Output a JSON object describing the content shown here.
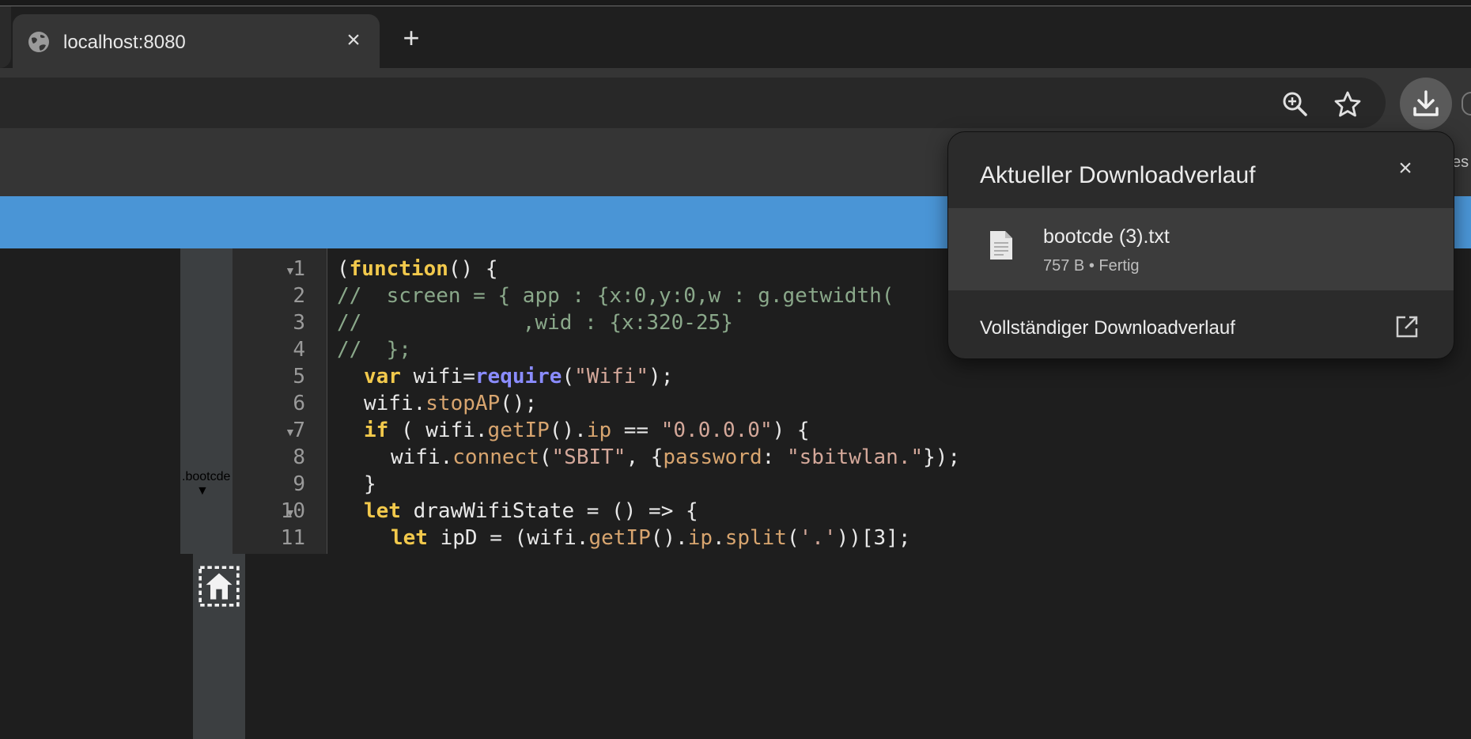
{
  "tab": {
    "title": "localhost:8080",
    "close_label": "×"
  },
  "new_tab_label": "+",
  "bookmarks_edge_text": "es",
  "editor": {
    "filename": ".bootcde",
    "lines": [
      "1",
      "2",
      "3",
      "4",
      "5",
      "6",
      "7",
      "8",
      "9",
      "10",
      "11"
    ],
    "code": {
      "l1_a": "(",
      "l1_kw": "function",
      "l1_b": "() {",
      "l2": "//  screen = { app : {x:0,y:0,w : g.getwidth(",
      "l3": "//             ,wid : {x:320-25}",
      "l4": "//  };",
      "l5_kw": "var",
      "l5_a": " wifi=",
      "l5_fn": "require",
      "l5_b": "(",
      "l5_str": "\"Wifi\"",
      "l5_c": ");",
      "l6_a": "wifi.",
      "l6_prop": "stopAP",
      "l6_b": "();",
      "l7_kw": "if",
      "l7_a": " ( wifi.",
      "l7_prop1": "getIP",
      "l7_b": "().",
      "l7_prop2": "ip",
      "l7_c": " == ",
      "l7_str": "\"0.0.0.0\"",
      "l7_d": ") {",
      "l8_a": "wifi.",
      "l8_prop1": "connect",
      "l8_b": "(",
      "l8_str1": "\"SBIT\"",
      "l8_c": ", {",
      "l8_prop2": "password",
      "l8_d": ": ",
      "l8_str2": "\"sbitwlan.\"",
      "l8_e": "});",
      "l9": "}",
      "l10_kw": "let",
      "l10_a": " drawWifiState = () => {",
      "l11_kw": "let",
      "l11_a": " ipD = (wifi.",
      "l11_prop1": "getIP",
      "l11_b": "().",
      "l11_prop2": "ip",
      "l11_c": ".",
      "l11_prop3": "split",
      "l11_d": "(",
      "l11_str": "'.'",
      "l11_e": "))[3];"
    }
  },
  "downloads": {
    "title": "Aktueller Downloadverlauf",
    "close_label": "×",
    "item": {
      "filename": "bootcde (3).txt",
      "meta": "757 B • Fertig"
    },
    "full_history_label": "Vollständiger Downloadverlauf"
  },
  "colors": {
    "accent_blue": "#4a95d6",
    "keyword": "#f2c94c",
    "function": "#8a8cff",
    "string": "#d4a89a",
    "comment": "#8aa88a"
  }
}
